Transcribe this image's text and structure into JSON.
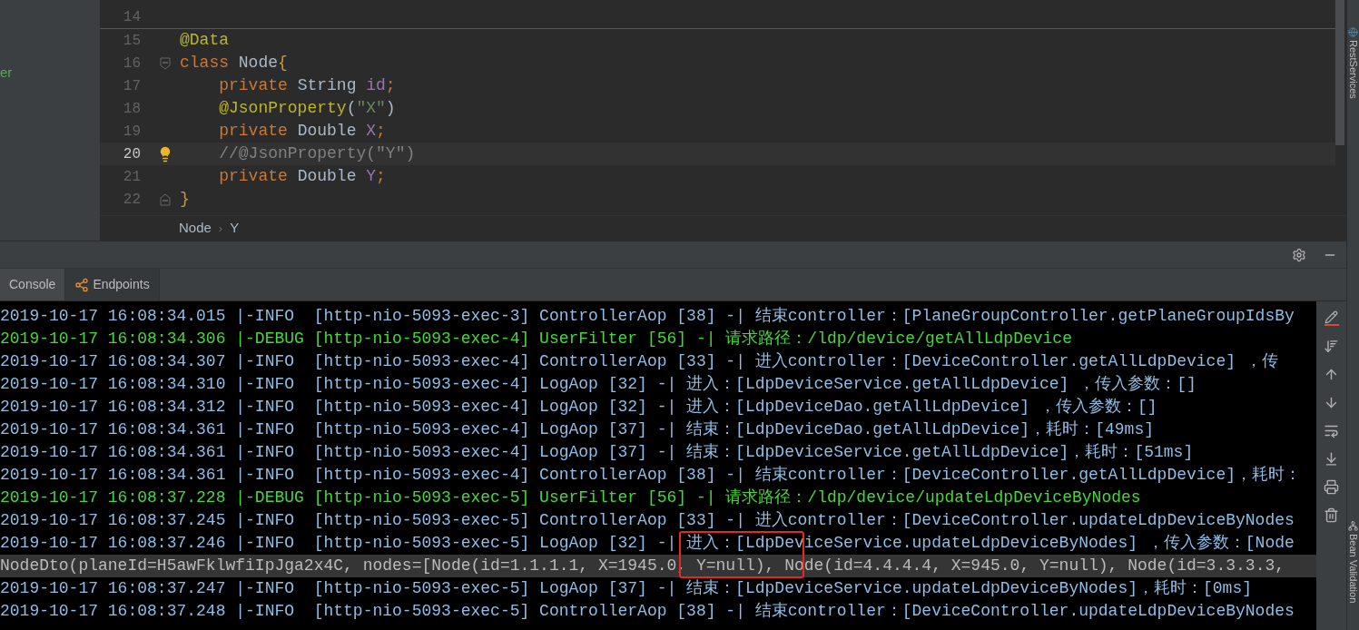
{
  "sidebar": {
    "text": "er"
  },
  "editor": {
    "lines": [
      {
        "number": "14",
        "current": false,
        "kind": "code",
        "separator": true
      },
      {
        "number": "15",
        "current": false,
        "kind": "code",
        "separator": false,
        "tokens": [
          {
            "kind": "annotation",
            "text": "@Data"
          }
        ]
      },
      {
        "number": "16",
        "current": false,
        "kind": "fold_start",
        "separator": false,
        "tokens": [
          {
            "kind": "keyword",
            "text": "class "
          },
          {
            "kind": "plain",
            "text": "Node"
          },
          {
            "kind": "brace",
            "text": "{"
          }
        ]
      },
      {
        "number": "17",
        "current": false,
        "kind": "code",
        "separator": false,
        "tokens": [
          {
            "kind": "keyword",
            "text": "    private "
          },
          {
            "kind": "plain",
            "text": "String "
          },
          {
            "kind": "field",
            "text": "id"
          },
          {
            "kind": "keyword",
            "text": ";"
          }
        ]
      },
      {
        "number": "18",
        "current": false,
        "kind": "code",
        "separator": false,
        "tokens": [
          {
            "kind": "annotation",
            "text": "    @JsonProperty"
          },
          {
            "kind": "plain",
            "text": "("
          },
          {
            "kind": "string",
            "text": "\"X\""
          },
          {
            "kind": "plain",
            "text": ")"
          }
        ]
      },
      {
        "number": "19",
        "current": false,
        "kind": "code",
        "separator": false,
        "tokens": [
          {
            "kind": "keyword",
            "text": "    private "
          },
          {
            "kind": "plain",
            "text": "Double "
          },
          {
            "kind": "field",
            "text": "X"
          },
          {
            "kind": "keyword",
            "text": ";"
          }
        ]
      },
      {
        "number": "20",
        "current": true,
        "kind": "code",
        "separator": false,
        "tokens": [
          {
            "kind": "comment",
            "text": "    //@JsonProperty(\"Y\")"
          }
        ]
      },
      {
        "number": "21",
        "current": false,
        "kind": "code",
        "separator": false,
        "tokens": [
          {
            "kind": "keyword",
            "text": "    private "
          },
          {
            "kind": "plain",
            "text": "Double "
          },
          {
            "kind": "field",
            "text": "Y"
          },
          {
            "kind": "keyword",
            "text": ";"
          }
        ]
      },
      {
        "number": "22",
        "current": false,
        "kind": "fold_end",
        "separator": false,
        "tokens": [
          {
            "kind": "brace",
            "text": "}"
          }
        ]
      }
    ],
    "breadcrumb": [
      "Node",
      "›",
      "Y"
    ]
  },
  "tool_window": {
    "tabs": [
      {
        "label": "Console",
        "selected": true
      },
      {
        "label": "Endpoints",
        "selected": false
      }
    ]
  },
  "console": {
    "lines": [
      {
        "kind": "info",
        "highlighted": false,
        "text": "2019-10-17 16:08:34.015 |-INFO  [http-nio-5093-exec-3] ControllerAop [38] -| 结束controller：[PlaneGroupController.getPlaneGroupIdsBy"
      },
      {
        "kind": "debug",
        "highlighted": false,
        "text": "2019-10-17 16:08:34.306 |-DEBUG [http-nio-5093-exec-4] UserFilter [56] -| 请求路径：/ldp/device/getAllLdpDevice"
      },
      {
        "kind": "info",
        "highlighted": false,
        "text": "2019-10-17 16:08:34.307 |-INFO  [http-nio-5093-exec-4] ControllerAop [33] -| 进入controller：[DeviceController.getAllLdpDevice] ，传"
      },
      {
        "kind": "info",
        "highlighted": false,
        "text": "2019-10-17 16:08:34.310 |-INFO  [http-nio-5093-exec-4] LogAop [32] -| 进入：[LdpDeviceService.getAllLdpDevice] ，传入参数：[]"
      },
      {
        "kind": "info",
        "highlighted": false,
        "text": "2019-10-17 16:08:34.312 |-INFO  [http-nio-5093-exec-4] LogAop [32] -| 进入：[LdpDeviceDao.getAllLdpDevice] ，传入参数：[]"
      },
      {
        "kind": "info",
        "highlighted": false,
        "text": "2019-10-17 16:08:34.361 |-INFO  [http-nio-5093-exec-4] LogAop [37] -| 结束：[LdpDeviceDao.getAllLdpDevice]，耗时：[49ms]"
      },
      {
        "kind": "info",
        "highlighted": false,
        "text": "2019-10-17 16:08:34.361 |-INFO  [http-nio-5093-exec-4] LogAop [37] -| 结束：[LdpDeviceService.getAllLdpDevice]，耗时：[51ms]"
      },
      {
        "kind": "info",
        "highlighted": false,
        "text": "2019-10-17 16:08:34.361 |-INFO  [http-nio-5093-exec-4] ControllerAop [38] -| 结束controller：[DeviceController.getAllLdpDevice]，耗时："
      },
      {
        "kind": "debug",
        "highlighted": false,
        "text": "2019-10-17 16:08:37.228 |-DEBUG [http-nio-5093-exec-5] UserFilter [56] -| 请求路径：/ldp/device/updateLdpDeviceByNodes"
      },
      {
        "kind": "info",
        "highlighted": false,
        "text": "2019-10-17 16:08:37.245 |-INFO  [http-nio-5093-exec-5] ControllerAop [33] -| 进入controller：[DeviceController.updateLdpDeviceByNodes"
      },
      {
        "kind": "info",
        "highlighted": false,
        "text": "2019-10-17 16:08:37.246 |-INFO  [http-nio-5093-exec-5] LogAop [32] -| 进入：[LdpDeviceService.updateLdpDeviceByNodes] ，传入参数：[Node"
      },
      {
        "kind": "plain",
        "highlighted": true,
        "text": "NodeDto(planeId=H5awFklwfiIpJga2x4C, nodes=[Node(id=1.1.1.1, X=1945.0, Y=null), Node(id=4.4.4.4, X=945.0, Y=null), Node(id=3.3.3.3,"
      },
      {
        "kind": "info",
        "highlighted": false,
        "text": "2019-10-17 16:08:37.247 |-INFO  [http-nio-5093-exec-5] LogAop [37] -| 结束：[LdpDeviceService.updateLdpDeviceByNodes]，耗时：[0ms]"
      },
      {
        "kind": "info",
        "highlighted": false,
        "text": "2019-10-17 16:08:37.248 |-INFO  [http-nio-5093-exec-5] ControllerAop [38] -| 结束controller：[DeviceController.updateLdpDeviceByNodes"
      }
    ]
  },
  "side_strip": [
    "RestServices",
    "Bean Validation"
  ]
}
